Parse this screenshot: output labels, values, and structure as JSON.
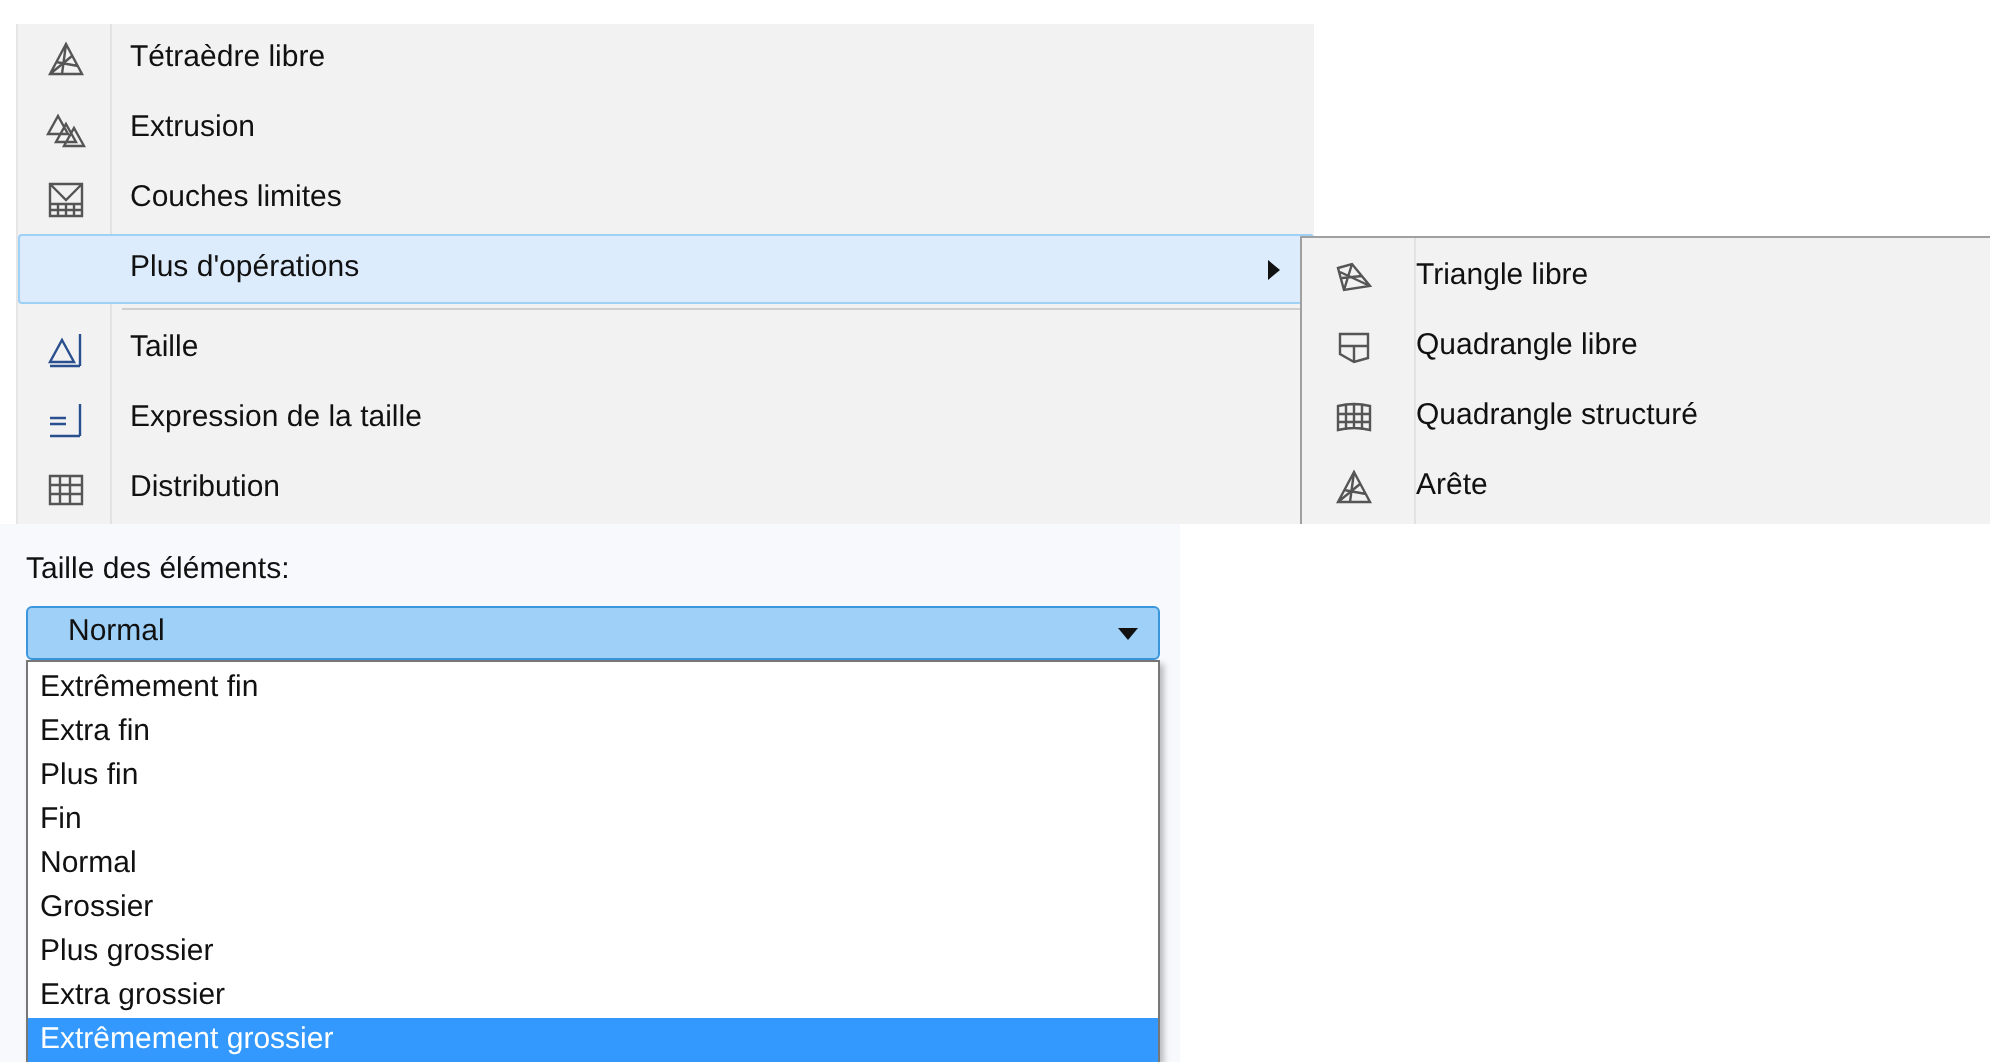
{
  "menu": {
    "items": [
      {
        "label": "Tétraèdre libre",
        "selected": false,
        "has_submenu": false
      },
      {
        "label": "Extrusion",
        "selected": false,
        "has_submenu": false
      },
      {
        "label": "Couches limites",
        "selected": false,
        "has_submenu": false
      },
      {
        "label": "Plus d'opérations",
        "selected": true,
        "has_submenu": true
      },
      {
        "label": "Taille",
        "selected": false,
        "has_submenu": false
      },
      {
        "label": "Expression de la taille",
        "selected": false,
        "has_submenu": false
      },
      {
        "label": "Distribution",
        "selected": false,
        "has_submenu": false
      }
    ]
  },
  "submenu": {
    "items": [
      {
        "label": "Triangle libre"
      },
      {
        "label": "Quadrangle libre"
      },
      {
        "label": "Quadrangle structuré"
      },
      {
        "label": "Arête"
      }
    ]
  },
  "element_size": {
    "label": "Taille des éléments:",
    "value": "Normal",
    "expanded": true,
    "options": [
      {
        "label": "Extrêmement fin",
        "highlighted": false
      },
      {
        "label": "Extra fin",
        "highlighted": false
      },
      {
        "label": "Plus fin",
        "highlighted": false
      },
      {
        "label": "Fin",
        "highlighted": false
      },
      {
        "label": "Normal",
        "highlighted": false
      },
      {
        "label": "Grossier",
        "highlighted": false
      },
      {
        "label": "Plus grossier",
        "highlighted": false
      },
      {
        "label": "Extra grossier",
        "highlighted": false
      },
      {
        "label": "Extrêmement grossier",
        "highlighted": true
      }
    ]
  }
}
